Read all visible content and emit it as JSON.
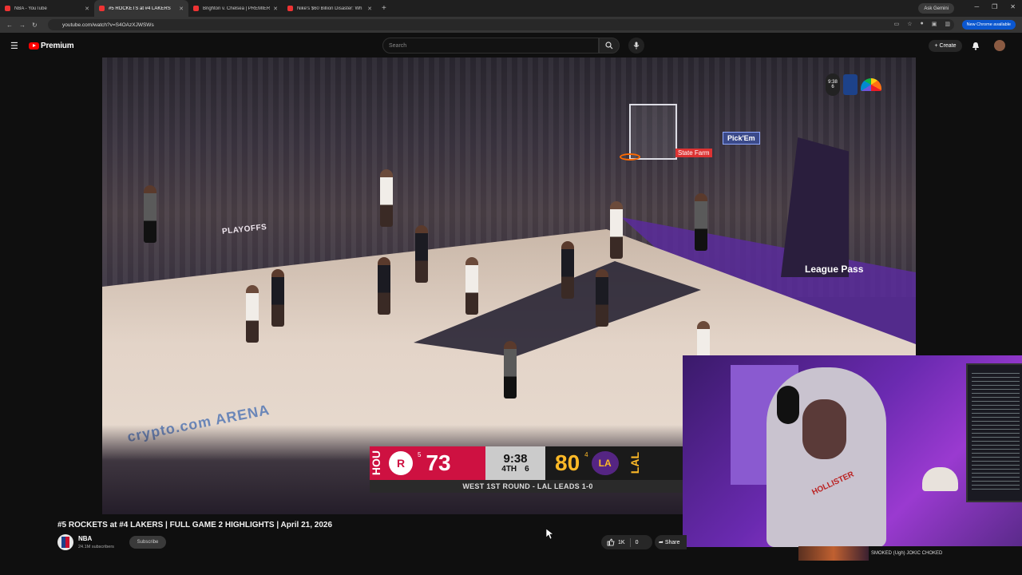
{
  "browser": {
    "tabs": [
      {
        "title": "NBA - YouTube",
        "active": false
      },
      {
        "title": "#5 ROCKETS at #4 LAKERS",
        "active": true
      },
      {
        "title": "Brighton v. Chelsea | PREMIER",
        "active": false
      },
      {
        "title": "Nike's $60 Billion Disaster: Wh",
        "active": false
      }
    ],
    "ask_gemini": "Ask Gemini",
    "url": "youtube.com/watch?v=S4OAzXJWSWs",
    "new_chrome": "New Chrome available"
  },
  "youtube": {
    "logo": "Premium",
    "search_placeholder": "Search",
    "create_label": "Create"
  },
  "video": {
    "overlay": {
      "arena": "crypto.com ARENA",
      "playoffs": "PLAYOFFS",
      "state_farm": "State Farm",
      "pick_em": "Pick'Em",
      "league_pass": "League Pass",
      "bug_time": "9:38",
      "bug_period": "6"
    },
    "scorebug": {
      "away_abbr": "HOU",
      "away_seed": "5",
      "away_score": "73",
      "clock": "9:38",
      "quarter": "4TH",
      "shot_clock": "6",
      "home_score": "80",
      "home_seed": "4",
      "home_abbr": "LAL",
      "series": "WEST 1ST ROUND - LAL LEADS 1-0"
    }
  },
  "meta": {
    "title": "#5 ROCKETS at #4 LAKERS | FULL GAME 2 HIGHLIGHTS | April 21, 2026",
    "channel": "NBA",
    "subscribers": "24.1M subscribers",
    "subscribe": "Subscribe",
    "likes": "1K",
    "dislikes": "0",
    "share": "Share"
  },
  "webcam": {
    "hoodie_text": "HOLLISTER",
    "chat_text": "SMOKED (Ugh) JOKIC CHOKED"
  },
  "colors": {
    "rockets_red": "#ce1141",
    "lakers_gold": "#fdb927",
    "lakers_purple": "#552583",
    "youtube_red": "#ff0000"
  }
}
